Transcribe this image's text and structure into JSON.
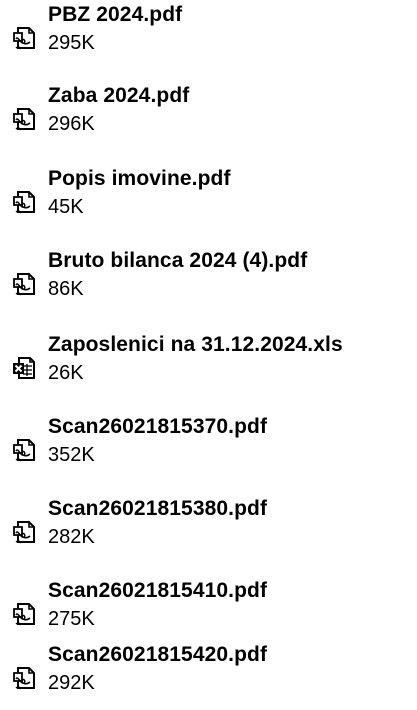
{
  "attachments": [
    {
      "name": "PBZ 2024.pdf",
      "size": "295K",
      "icon": "pdf-file-icon"
    },
    {
      "name": "Zaba 2024.pdf",
      "size": "296K",
      "icon": "pdf-file-icon"
    },
    {
      "name": "Popis imovine.pdf",
      "size": "45K",
      "icon": "pdf-file-icon"
    },
    {
      "name": "Bruto bilanca 2024 (4).pdf",
      "size": "86K",
      "icon": "pdf-file-icon"
    },
    {
      "name": "Zaposlenici na 31.12.2024.xls",
      "size": "26K",
      "icon": "excel-file-icon"
    },
    {
      "name": "Scan26021815370.pdf",
      "size": "352K",
      "icon": "pdf-file-icon"
    },
    {
      "name": "Scan26021815380.pdf",
      "size": "282K",
      "icon": "pdf-file-icon"
    },
    {
      "name": "Scan26021815410.pdf",
      "size": "275K",
      "icon": "pdf-file-icon"
    },
    {
      "name": "Scan26021815420.pdf",
      "size": "292K",
      "icon": "pdf-file-icon"
    }
  ]
}
